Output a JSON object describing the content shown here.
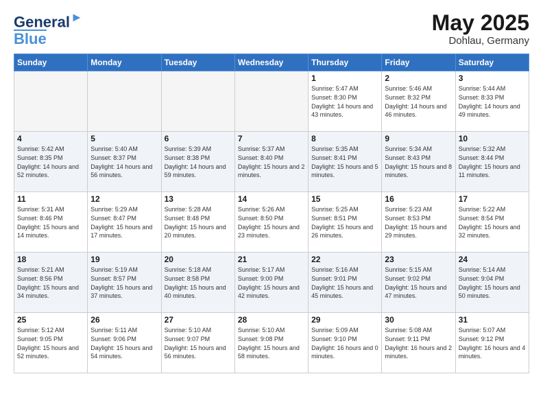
{
  "logo": {
    "line1": "General",
    "line2": "Blue"
  },
  "header": {
    "title": "May 2025",
    "subtitle": "Dohlau, Germany"
  },
  "weekdays": [
    "Sunday",
    "Monday",
    "Tuesday",
    "Wednesday",
    "Thursday",
    "Friday",
    "Saturday"
  ],
  "weeks": [
    [
      {
        "day": "",
        "empty": true
      },
      {
        "day": "",
        "empty": true
      },
      {
        "day": "",
        "empty": true
      },
      {
        "day": "",
        "empty": true
      },
      {
        "day": "1",
        "sunrise": "Sunrise: 5:47 AM",
        "sunset": "Sunset: 8:30 PM",
        "daylight": "Daylight: 14 hours and 43 minutes."
      },
      {
        "day": "2",
        "sunrise": "Sunrise: 5:46 AM",
        "sunset": "Sunset: 8:32 PM",
        "daylight": "Daylight: 14 hours and 46 minutes."
      },
      {
        "day": "3",
        "sunrise": "Sunrise: 5:44 AM",
        "sunset": "Sunset: 8:33 PM",
        "daylight": "Daylight: 14 hours and 49 minutes."
      }
    ],
    [
      {
        "day": "4",
        "sunrise": "Sunrise: 5:42 AM",
        "sunset": "Sunset: 8:35 PM",
        "daylight": "Daylight: 14 hours and 52 minutes."
      },
      {
        "day": "5",
        "sunrise": "Sunrise: 5:40 AM",
        "sunset": "Sunset: 8:37 PM",
        "daylight": "Daylight: 14 hours and 56 minutes."
      },
      {
        "day": "6",
        "sunrise": "Sunrise: 5:39 AM",
        "sunset": "Sunset: 8:38 PM",
        "daylight": "Daylight: 14 hours and 59 minutes."
      },
      {
        "day": "7",
        "sunrise": "Sunrise: 5:37 AM",
        "sunset": "Sunset: 8:40 PM",
        "daylight": "Daylight: 15 hours and 2 minutes."
      },
      {
        "day": "8",
        "sunrise": "Sunrise: 5:35 AM",
        "sunset": "Sunset: 8:41 PM",
        "daylight": "Daylight: 15 hours and 5 minutes."
      },
      {
        "day": "9",
        "sunrise": "Sunrise: 5:34 AM",
        "sunset": "Sunset: 8:43 PM",
        "daylight": "Daylight: 15 hours and 8 minutes."
      },
      {
        "day": "10",
        "sunrise": "Sunrise: 5:32 AM",
        "sunset": "Sunset: 8:44 PM",
        "daylight": "Daylight: 15 hours and 11 minutes."
      }
    ],
    [
      {
        "day": "11",
        "sunrise": "Sunrise: 5:31 AM",
        "sunset": "Sunset: 8:46 PM",
        "daylight": "Daylight: 15 hours and 14 minutes."
      },
      {
        "day": "12",
        "sunrise": "Sunrise: 5:29 AM",
        "sunset": "Sunset: 8:47 PM",
        "daylight": "Daylight: 15 hours and 17 minutes."
      },
      {
        "day": "13",
        "sunrise": "Sunrise: 5:28 AM",
        "sunset": "Sunset: 8:48 PM",
        "daylight": "Daylight: 15 hours and 20 minutes."
      },
      {
        "day": "14",
        "sunrise": "Sunrise: 5:26 AM",
        "sunset": "Sunset: 8:50 PM",
        "daylight": "Daylight: 15 hours and 23 minutes."
      },
      {
        "day": "15",
        "sunrise": "Sunrise: 5:25 AM",
        "sunset": "Sunset: 8:51 PM",
        "daylight": "Daylight: 15 hours and 26 minutes."
      },
      {
        "day": "16",
        "sunrise": "Sunrise: 5:23 AM",
        "sunset": "Sunset: 8:53 PM",
        "daylight": "Daylight: 15 hours and 29 minutes."
      },
      {
        "day": "17",
        "sunrise": "Sunrise: 5:22 AM",
        "sunset": "Sunset: 8:54 PM",
        "daylight": "Daylight: 15 hours and 32 minutes."
      }
    ],
    [
      {
        "day": "18",
        "sunrise": "Sunrise: 5:21 AM",
        "sunset": "Sunset: 8:56 PM",
        "daylight": "Daylight: 15 hours and 34 minutes."
      },
      {
        "day": "19",
        "sunrise": "Sunrise: 5:19 AM",
        "sunset": "Sunset: 8:57 PM",
        "daylight": "Daylight: 15 hours and 37 minutes."
      },
      {
        "day": "20",
        "sunrise": "Sunrise: 5:18 AM",
        "sunset": "Sunset: 8:58 PM",
        "daylight": "Daylight: 15 hours and 40 minutes."
      },
      {
        "day": "21",
        "sunrise": "Sunrise: 5:17 AM",
        "sunset": "Sunset: 9:00 PM",
        "daylight": "Daylight: 15 hours and 42 minutes."
      },
      {
        "day": "22",
        "sunrise": "Sunrise: 5:16 AM",
        "sunset": "Sunset: 9:01 PM",
        "daylight": "Daylight: 15 hours and 45 minutes."
      },
      {
        "day": "23",
        "sunrise": "Sunrise: 5:15 AM",
        "sunset": "Sunset: 9:02 PM",
        "daylight": "Daylight: 15 hours and 47 minutes."
      },
      {
        "day": "24",
        "sunrise": "Sunrise: 5:14 AM",
        "sunset": "Sunset: 9:04 PM",
        "daylight": "Daylight: 15 hours and 50 minutes."
      }
    ],
    [
      {
        "day": "25",
        "sunrise": "Sunrise: 5:12 AM",
        "sunset": "Sunset: 9:05 PM",
        "daylight": "Daylight: 15 hours and 52 minutes."
      },
      {
        "day": "26",
        "sunrise": "Sunrise: 5:11 AM",
        "sunset": "Sunset: 9:06 PM",
        "daylight": "Daylight: 15 hours and 54 minutes."
      },
      {
        "day": "27",
        "sunrise": "Sunrise: 5:10 AM",
        "sunset": "Sunset: 9:07 PM",
        "daylight": "Daylight: 15 hours and 56 minutes."
      },
      {
        "day": "28",
        "sunrise": "Sunrise: 5:10 AM",
        "sunset": "Sunset: 9:08 PM",
        "daylight": "Daylight: 15 hours and 58 minutes."
      },
      {
        "day": "29",
        "sunrise": "Sunrise: 5:09 AM",
        "sunset": "Sunset: 9:10 PM",
        "daylight": "Daylight: 16 hours and 0 minutes."
      },
      {
        "day": "30",
        "sunrise": "Sunrise: 5:08 AM",
        "sunset": "Sunset: 9:11 PM",
        "daylight": "Daylight: 16 hours and 2 minutes."
      },
      {
        "day": "31",
        "sunrise": "Sunrise: 5:07 AM",
        "sunset": "Sunset: 9:12 PM",
        "daylight": "Daylight: 16 hours and 4 minutes."
      }
    ]
  ]
}
